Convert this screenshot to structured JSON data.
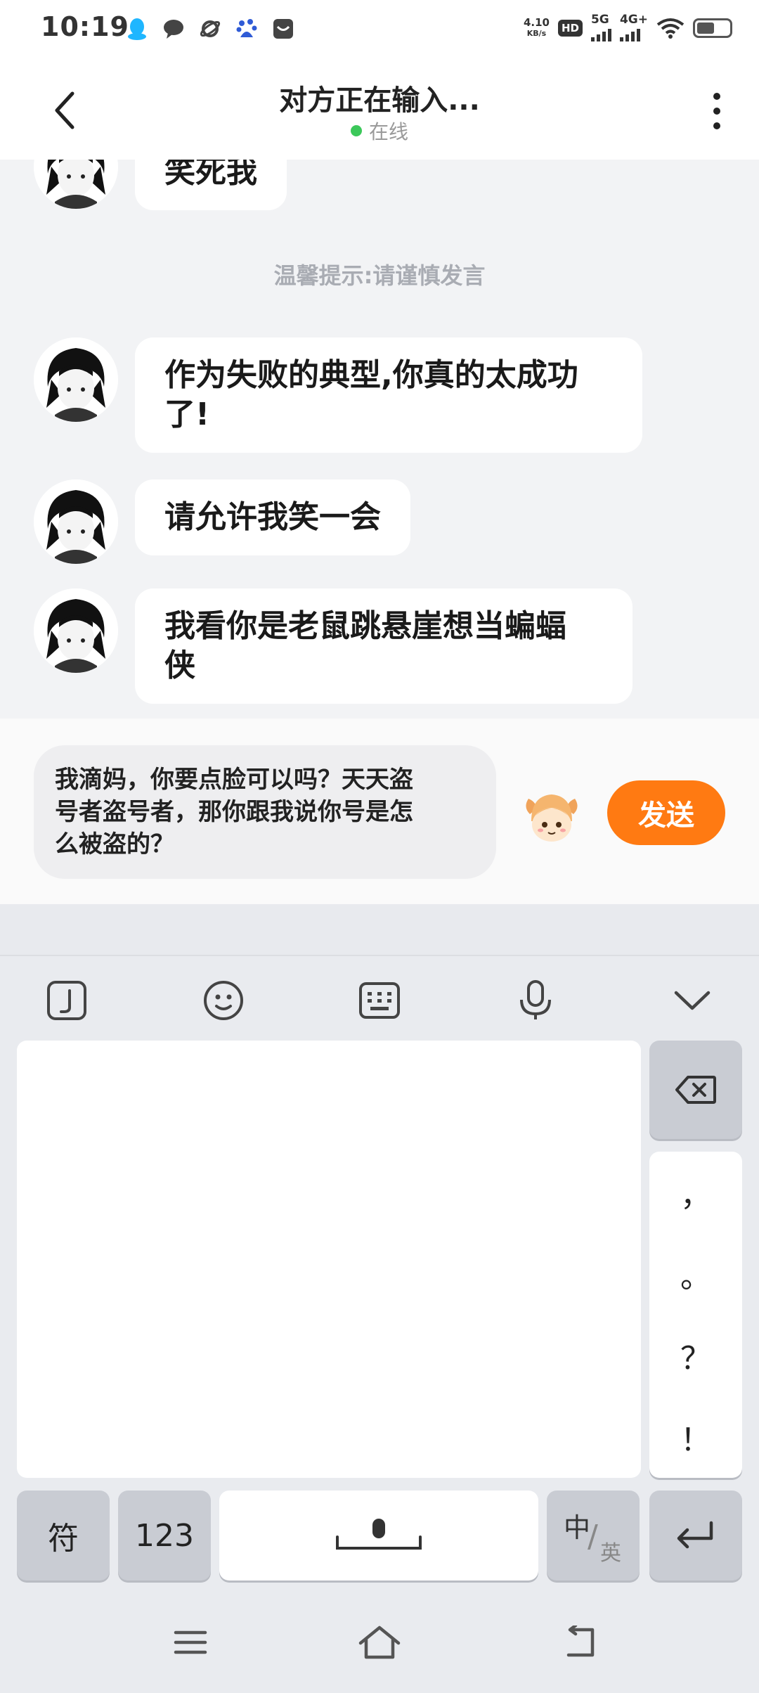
{
  "status_bar": {
    "time": "10:19",
    "net_speed_value": "4.10",
    "net_speed_unit": "KB/s",
    "hd_label": "HD",
    "sim1_label": "5G",
    "sim2_label": "4G+",
    "battery_level": 0.55,
    "icons": [
      "qq-icon",
      "message-icon",
      "planet-icon",
      "baidu-icon",
      "mail-icon",
      "wifi-icon",
      "battery-icon"
    ]
  },
  "header": {
    "title": "对方正在输入...",
    "status": "在线",
    "status_color": "#3cc85a"
  },
  "chat": {
    "partial_message": "笑死我",
    "tip": "温馨提示:请谨慎发言",
    "messages": [
      {
        "line1": "作为失败的典型,你真的太成功",
        "line2": "了!"
      },
      {
        "line1": "请允许我笑一会",
        "line2": ""
      },
      {
        "line1": "我看你是老鼠跳悬崖想当蝙蝠",
        "line2": "侠"
      }
    ]
  },
  "input": {
    "line1": "我滴妈，你要点脸可以吗？天天盗",
    "line2": "号者盗号者，那你跟我说你号是怎",
    "line3": "么被盗的？",
    "send_label": "发送",
    "send_color": "#ff7a12"
  },
  "keyboard": {
    "toolbar_icons": [
      "handwriting-icon",
      "emoji-icon",
      "keyboard-icon",
      "microphone-icon",
      "collapse-chevron-icon"
    ],
    "punctuation": [
      "，",
      "。",
      "？",
      "！"
    ],
    "symbols_label": "符",
    "numbers_label": "123",
    "zh_label": "中",
    "en_label": "英",
    "slash": "/"
  }
}
